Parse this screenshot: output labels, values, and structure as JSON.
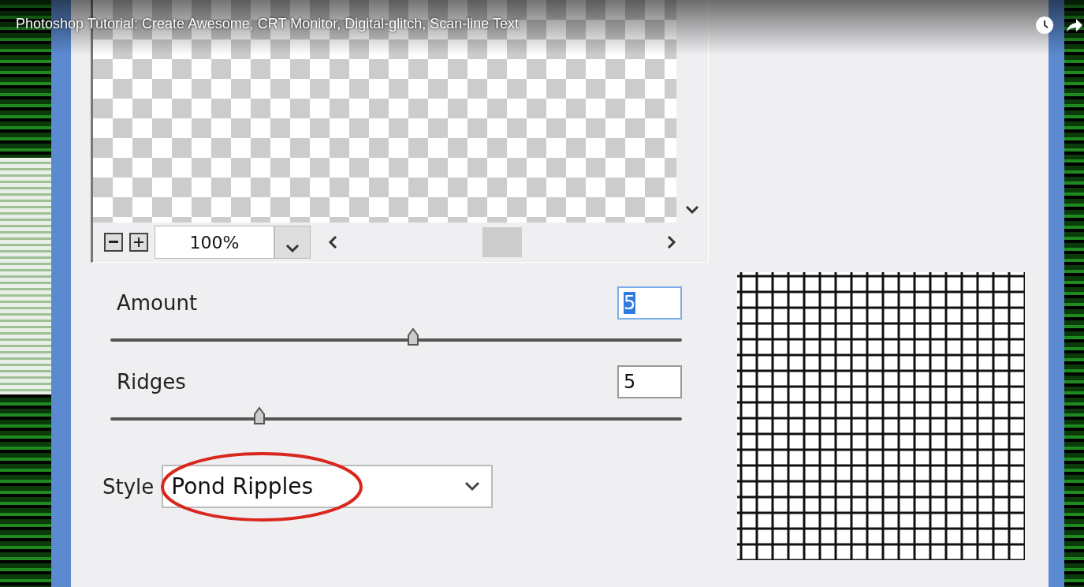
{
  "video": {
    "title": "Photoshop Tutorial: Create Awesome, CRT Monitor, Digital-glitch, Scan-line Text"
  },
  "preview": {
    "zoom": "100%"
  },
  "params": [
    {
      "label": "Amount",
      "value": "5",
      "focused": true,
      "level": 0.53
    },
    {
      "label": "Ridges",
      "value": "5",
      "focused": false,
      "level": 0.26
    }
  ],
  "style": {
    "label": "Style",
    "value": "Pond Ripples",
    "circled": true
  }
}
